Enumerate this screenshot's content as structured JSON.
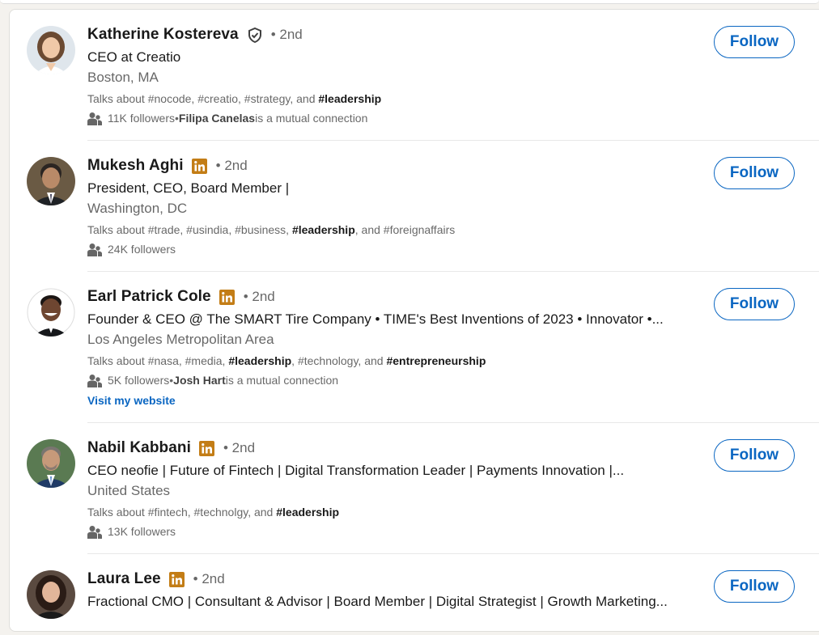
{
  "colors": {
    "accent": "#0a66c2",
    "premium_gold": "#c37d16"
  },
  "people": [
    {
      "name": "Katherine Kostereva",
      "badge": "verified-shield-icon",
      "degree": "• 2nd",
      "headline": "CEO at Creatio",
      "location": "Boston, MA",
      "talks_prefix": "Talks about #nocode, #creatio, #strategy, and ",
      "talks_bold": "#leadership",
      "followers": "11K followers",
      "mutual_sep": " • ",
      "mutual_name": "Filipa Canelas",
      "mutual_suffix": " is a mutual connection",
      "follow_label": "Follow"
    },
    {
      "name": "Mukesh Aghi",
      "badge": "linkedin-premium-icon",
      "degree": "• 2nd",
      "headline": "President, CEO, Board Member |",
      "location": "Washington, DC",
      "talks_prefix": "Talks about #trade, #usindia, #business, ",
      "talks_bold": "#leadership",
      "talks_suffix": ", and #foreignaffairs",
      "followers": "24K followers",
      "follow_label": "Follow"
    },
    {
      "name": "Earl Patrick Cole",
      "badge": "linkedin-premium-icon",
      "degree": "• 2nd",
      "headline": "Founder & CEO @ The SMART Tire Company • TIME's Best Inventions of 2023 • Innovator •...",
      "location": "Los Angeles Metropolitan Area",
      "talks_prefix": "Talks about #nasa, #media, ",
      "talks_bold": "#leadership",
      "talks_mid": ", #technology, and ",
      "talks_bold2": "#entrepreneurship",
      "followers": "5K followers",
      "mutual_sep": " • ",
      "mutual_name": "Josh Hart",
      "mutual_suffix": " is a mutual connection",
      "website": "Visit my website",
      "follow_label": "Follow"
    },
    {
      "name": "Nabil Kabbani",
      "badge": "linkedin-premium-icon",
      "degree": "• 2nd",
      "headline": "CEO neofie | Future of Fintech | Digital Transformation Leader | Payments Innovation |...",
      "location": "United States",
      "talks_prefix": "Talks about #fintech, #technolgy, and ",
      "talks_bold": "#leadership",
      "followers": "13K followers",
      "follow_label": "Follow"
    },
    {
      "name": "Laura Lee",
      "badge": "linkedin-premium-icon",
      "degree": "• 2nd",
      "headline": "Fractional CMO | Consultant & Advisor | Board Member | Digital Strategist | Growth Marketing...",
      "follow_label": "Follow"
    }
  ]
}
